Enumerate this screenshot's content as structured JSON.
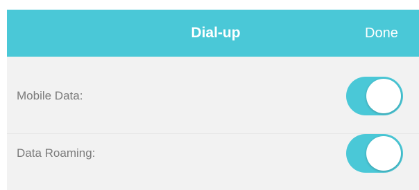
{
  "header": {
    "title": "Dial-up",
    "done_label": "Done"
  },
  "settings": [
    {
      "label": "Mobile Data:",
      "enabled": true
    },
    {
      "label": "Data Roaming:",
      "enabled": true
    }
  ],
  "colors": {
    "accent": "#4ac8d7",
    "background": "#f2f2f2",
    "label_text": "#7b7b7b",
    "header_text": "#ffffff"
  }
}
